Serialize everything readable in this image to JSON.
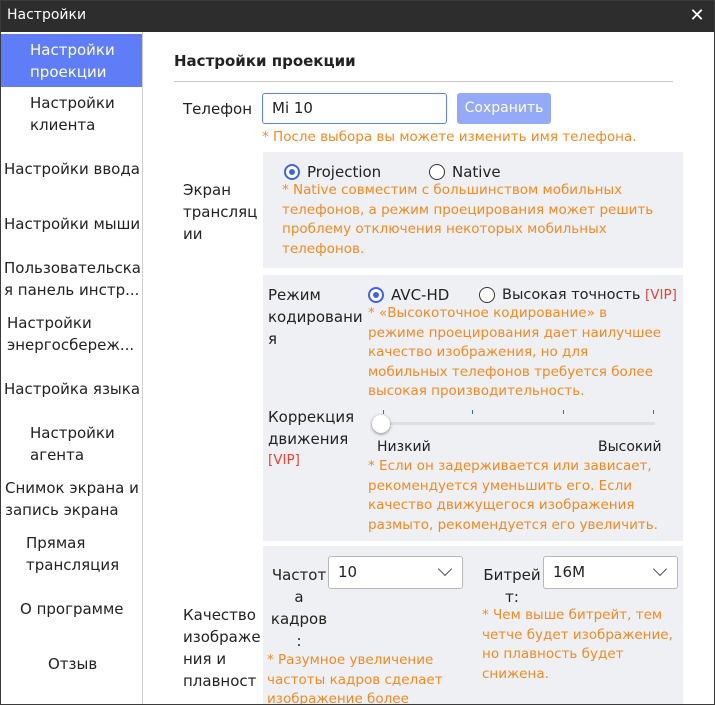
{
  "window": {
    "title": "Настройки"
  },
  "sidebar": {
    "items": [
      {
        "label": "Настройки проекции",
        "active": true
      },
      {
        "label": "Настройки клиента"
      },
      {
        "label": "Настройки ввода"
      },
      {
        "label": "Настройки мыши"
      },
      {
        "label": "Пользовательская панель инстр..."
      },
      {
        "label": "Настройки энергосбереж..."
      },
      {
        "label": "Настройка языка"
      },
      {
        "label": "Настройки агента"
      },
      {
        "label": "Снимок экрана и запись экрана"
      },
      {
        "label": "Прямая трансляция"
      },
      {
        "label": "О программе"
      },
      {
        "label": "Отзыв"
      }
    ]
  },
  "main": {
    "section_title": "Настройки проекции",
    "phone": {
      "label": "Телефон",
      "value": "Mi 10",
      "save_label": "Сохранить",
      "note": "* После выбора вы можете изменить имя телефона."
    },
    "screen_mode": {
      "label_lines": [
        "Экран",
        "трансляц",
        "ии"
      ],
      "options": [
        "Projection",
        "Native"
      ],
      "selected": "Projection",
      "note_lines": [
        "* Native совместим с большинством мобильных",
        "телефонов, а режим проецирования может решить",
        "проблему отключения некоторых мобильных",
        "телефонов."
      ]
    },
    "encoding": {
      "label_lines": [
        "Режим",
        "кодировани",
        "я"
      ],
      "options": [
        "AVC-HD",
        "Высокая точность"
      ],
      "option2_vip": "[VIP]",
      "selected": "AVC-HD",
      "note_lines": [
        "* «Высокоточное кодирование» в",
        "режиме проецирования дает наилучшее",
        "качество изображения, но для",
        "мобильных телефонов требуется более",
        "высокая производительность."
      ]
    },
    "motion": {
      "label_lines": [
        "Коррекция",
        "движения"
      ],
      "vip": "[VIP]",
      "slider_value": 0,
      "min_label": "Низкий",
      "max_label": "Высокий",
      "note_lines": [
        "* Если он задерживается или зависает,",
        "рекомендуется уменьшить его. Если",
        "качество движущегося изображения",
        "размыто, рекомендуется его увеличить."
      ]
    },
    "quality": {
      "label_lines": [
        "Качество",
        "изображе",
        "ния и",
        "плавност"
      ],
      "fps": {
        "label_lines": [
          "Частот",
          "а",
          "кадров",
          ":"
        ],
        "value": "10",
        "note_lines": [
          "* Разумное увеличение",
          "частоты кадров сделает",
          "изображение более"
        ]
      },
      "bitrate": {
        "label_lines": [
          "Битрей",
          "т:"
        ],
        "value": "16M",
        "note_lines": [
          "* Чем выше битрейт, тем",
          "четче будет изображение,",
          "но плавность будет",
          "снижена."
        ]
      }
    }
  }
}
